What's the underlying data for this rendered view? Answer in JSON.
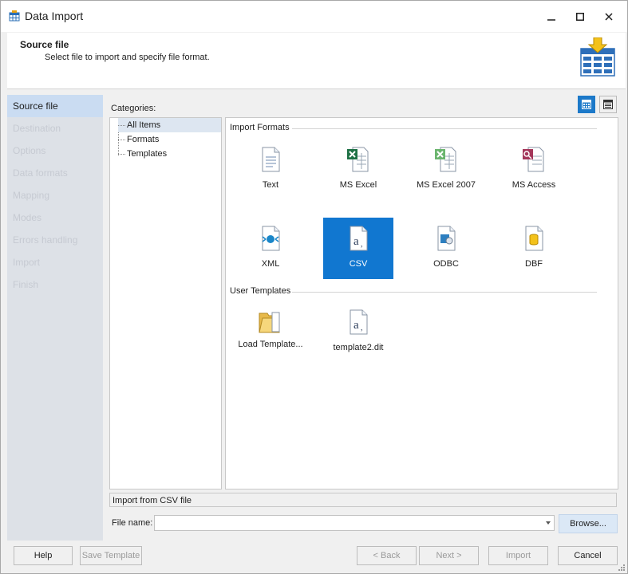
{
  "window": {
    "title": "Data Import",
    "app_icon": "table-icon",
    "controls": {
      "minimize": "minimize-icon",
      "maximize": "maximize-icon",
      "close": "close-icon"
    }
  },
  "header": {
    "title": "Source file",
    "subtitle": "Select file to import and specify file format.",
    "icon": "table-import-icon"
  },
  "steps": [
    {
      "label": "Source file",
      "active": true
    },
    {
      "label": "Destination"
    },
    {
      "label": "Options"
    },
    {
      "label": "Data formats"
    },
    {
      "label": "Mapping"
    },
    {
      "label": "Modes"
    },
    {
      "label": "Errors handling"
    },
    {
      "label": "Import"
    },
    {
      "label": "Finish"
    }
  ],
  "categories": {
    "label": "Categories:",
    "items": [
      "All Items",
      "Formats",
      "Templates"
    ],
    "selected": "All Items"
  },
  "view_toggle": {
    "large_icons": "large-icons-view-icon",
    "list": "list-view-icon",
    "active": "large_icons"
  },
  "gallery": {
    "import_formats_label": "Import Formats",
    "formats": [
      {
        "label": "Text",
        "icon": "text-file-icon"
      },
      {
        "label": "MS Excel",
        "icon": "excel-file-icon"
      },
      {
        "label": "MS Excel 2007",
        "icon": "excel-2007-file-icon"
      },
      {
        "label": "MS Access",
        "icon": "access-file-icon"
      },
      {
        "label": "XML",
        "icon": "xml-file-icon"
      },
      {
        "label": "CSV",
        "icon": "csv-file-icon",
        "selected": true
      },
      {
        "label": "ODBC",
        "icon": "odbc-icon"
      },
      {
        "label": "DBF",
        "icon": "dbf-file-icon"
      }
    ],
    "user_templates_label": "User Templates",
    "templates": [
      {
        "label": "Load Template...",
        "icon": "folder-icon"
      },
      {
        "label": "template2.dit",
        "icon": "template-file-icon"
      }
    ]
  },
  "status_text": "Import from CSV file",
  "file_name": {
    "label": "File name:",
    "value": "",
    "browse_label": "Browse..."
  },
  "buttons": {
    "help": "Help",
    "save_template": "Save Template",
    "back": "< Back",
    "next": "Next >",
    "import": "Import",
    "cancel": "Cancel"
  }
}
